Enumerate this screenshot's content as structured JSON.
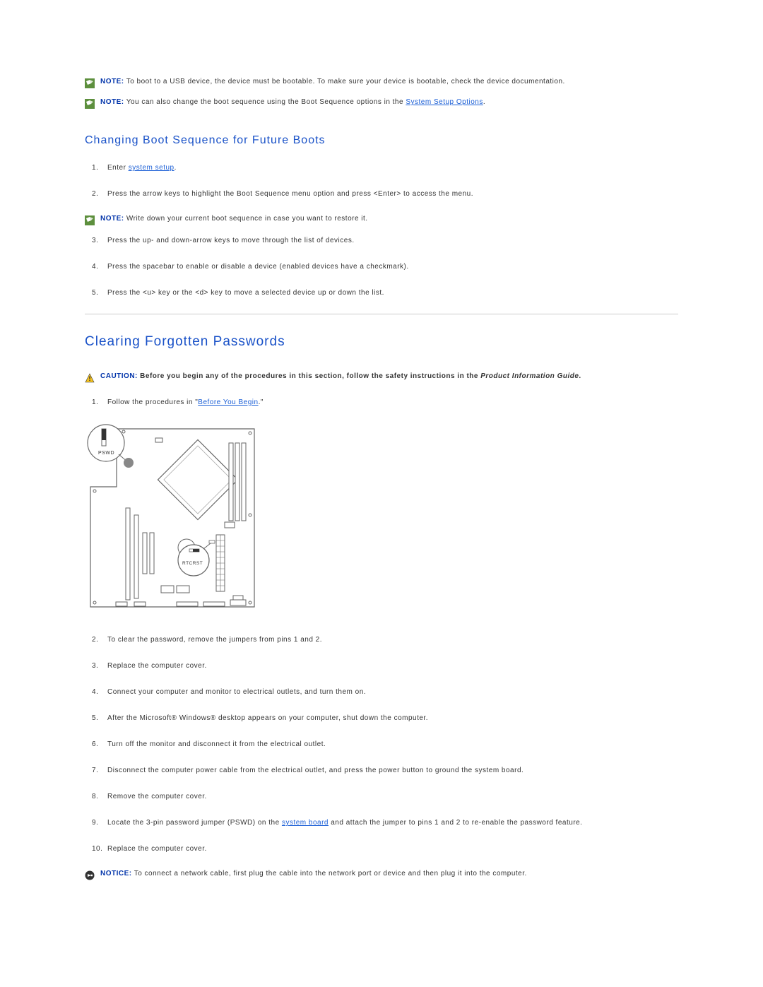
{
  "notes": {
    "n1_label": "NOTE:",
    "n1_text": " To boot to a USB device, the device must be bootable. To make sure your device is bootable, check the device documentation.",
    "n2_label": "NOTE:",
    "n2_text_a": " You can also change the boot sequence using the Boot Sequence options in the ",
    "n2_link": "System Setup Options",
    "n2_text_b": ".",
    "n3_label": "NOTE:",
    "n3_text": " Write down your current boot sequence in case you want to restore it."
  },
  "subheading": "Changing Boot Sequence for Future Boots",
  "list1": {
    "i1_a": "Enter ",
    "i1_link": "system setup",
    "i1_b": ".",
    "i2": "Press the arrow keys to highlight the Boot Sequence menu option and press <Enter> to access the menu.",
    "i3": "Press the up- and down-arrow keys to move through the list of devices.",
    "i4": "Press the spacebar to enable or disable a device (enabled devices have a checkmark).",
    "i5": "Press the <u> key or the <d> key to move a selected device up or down the list."
  },
  "heading": "Clearing Forgotten Passwords",
  "caution": {
    "label": "CAUTION: ",
    "text_a": "Before you begin any of the procedures in this section, follow the safety instructions in the ",
    "italic": "Product Information Guide",
    "text_b": "."
  },
  "list2": {
    "i1_a": "Follow the procedures in \"",
    "i1_link": "Before You Begin",
    "i1_b": ".\"",
    "i2": "To clear the password, remove the jumpers from pins 1 and 2.",
    "i3": "Replace the computer cover.",
    "i4": "Connect your computer and monitor to electrical outlets, and turn them on.",
    "i5": "After the Microsoft® Windows® desktop appears on your computer, shut down the computer.",
    "i6": "Turn off the monitor and disconnect it from the electrical outlet.",
    "i7": "Disconnect the computer power cable from the electrical outlet, and press the power button to ground the system board.",
    "i8": "Remove the computer cover.",
    "i9_a": "Locate the 3-pin password jumper (PSWD) on the ",
    "i9_link": "system board",
    "i9_b": " and attach the jumper to pins 1 and 2 to re-enable the password feature.",
    "i10": "Replace the computer cover."
  },
  "notice": {
    "label": "NOTICE:",
    "text": " To connect a network cable, first plug the cable into the network port or device and then plug it into the computer."
  },
  "board_labels": {
    "pswd": "PSWD",
    "rtcrst": "RTCRST"
  }
}
